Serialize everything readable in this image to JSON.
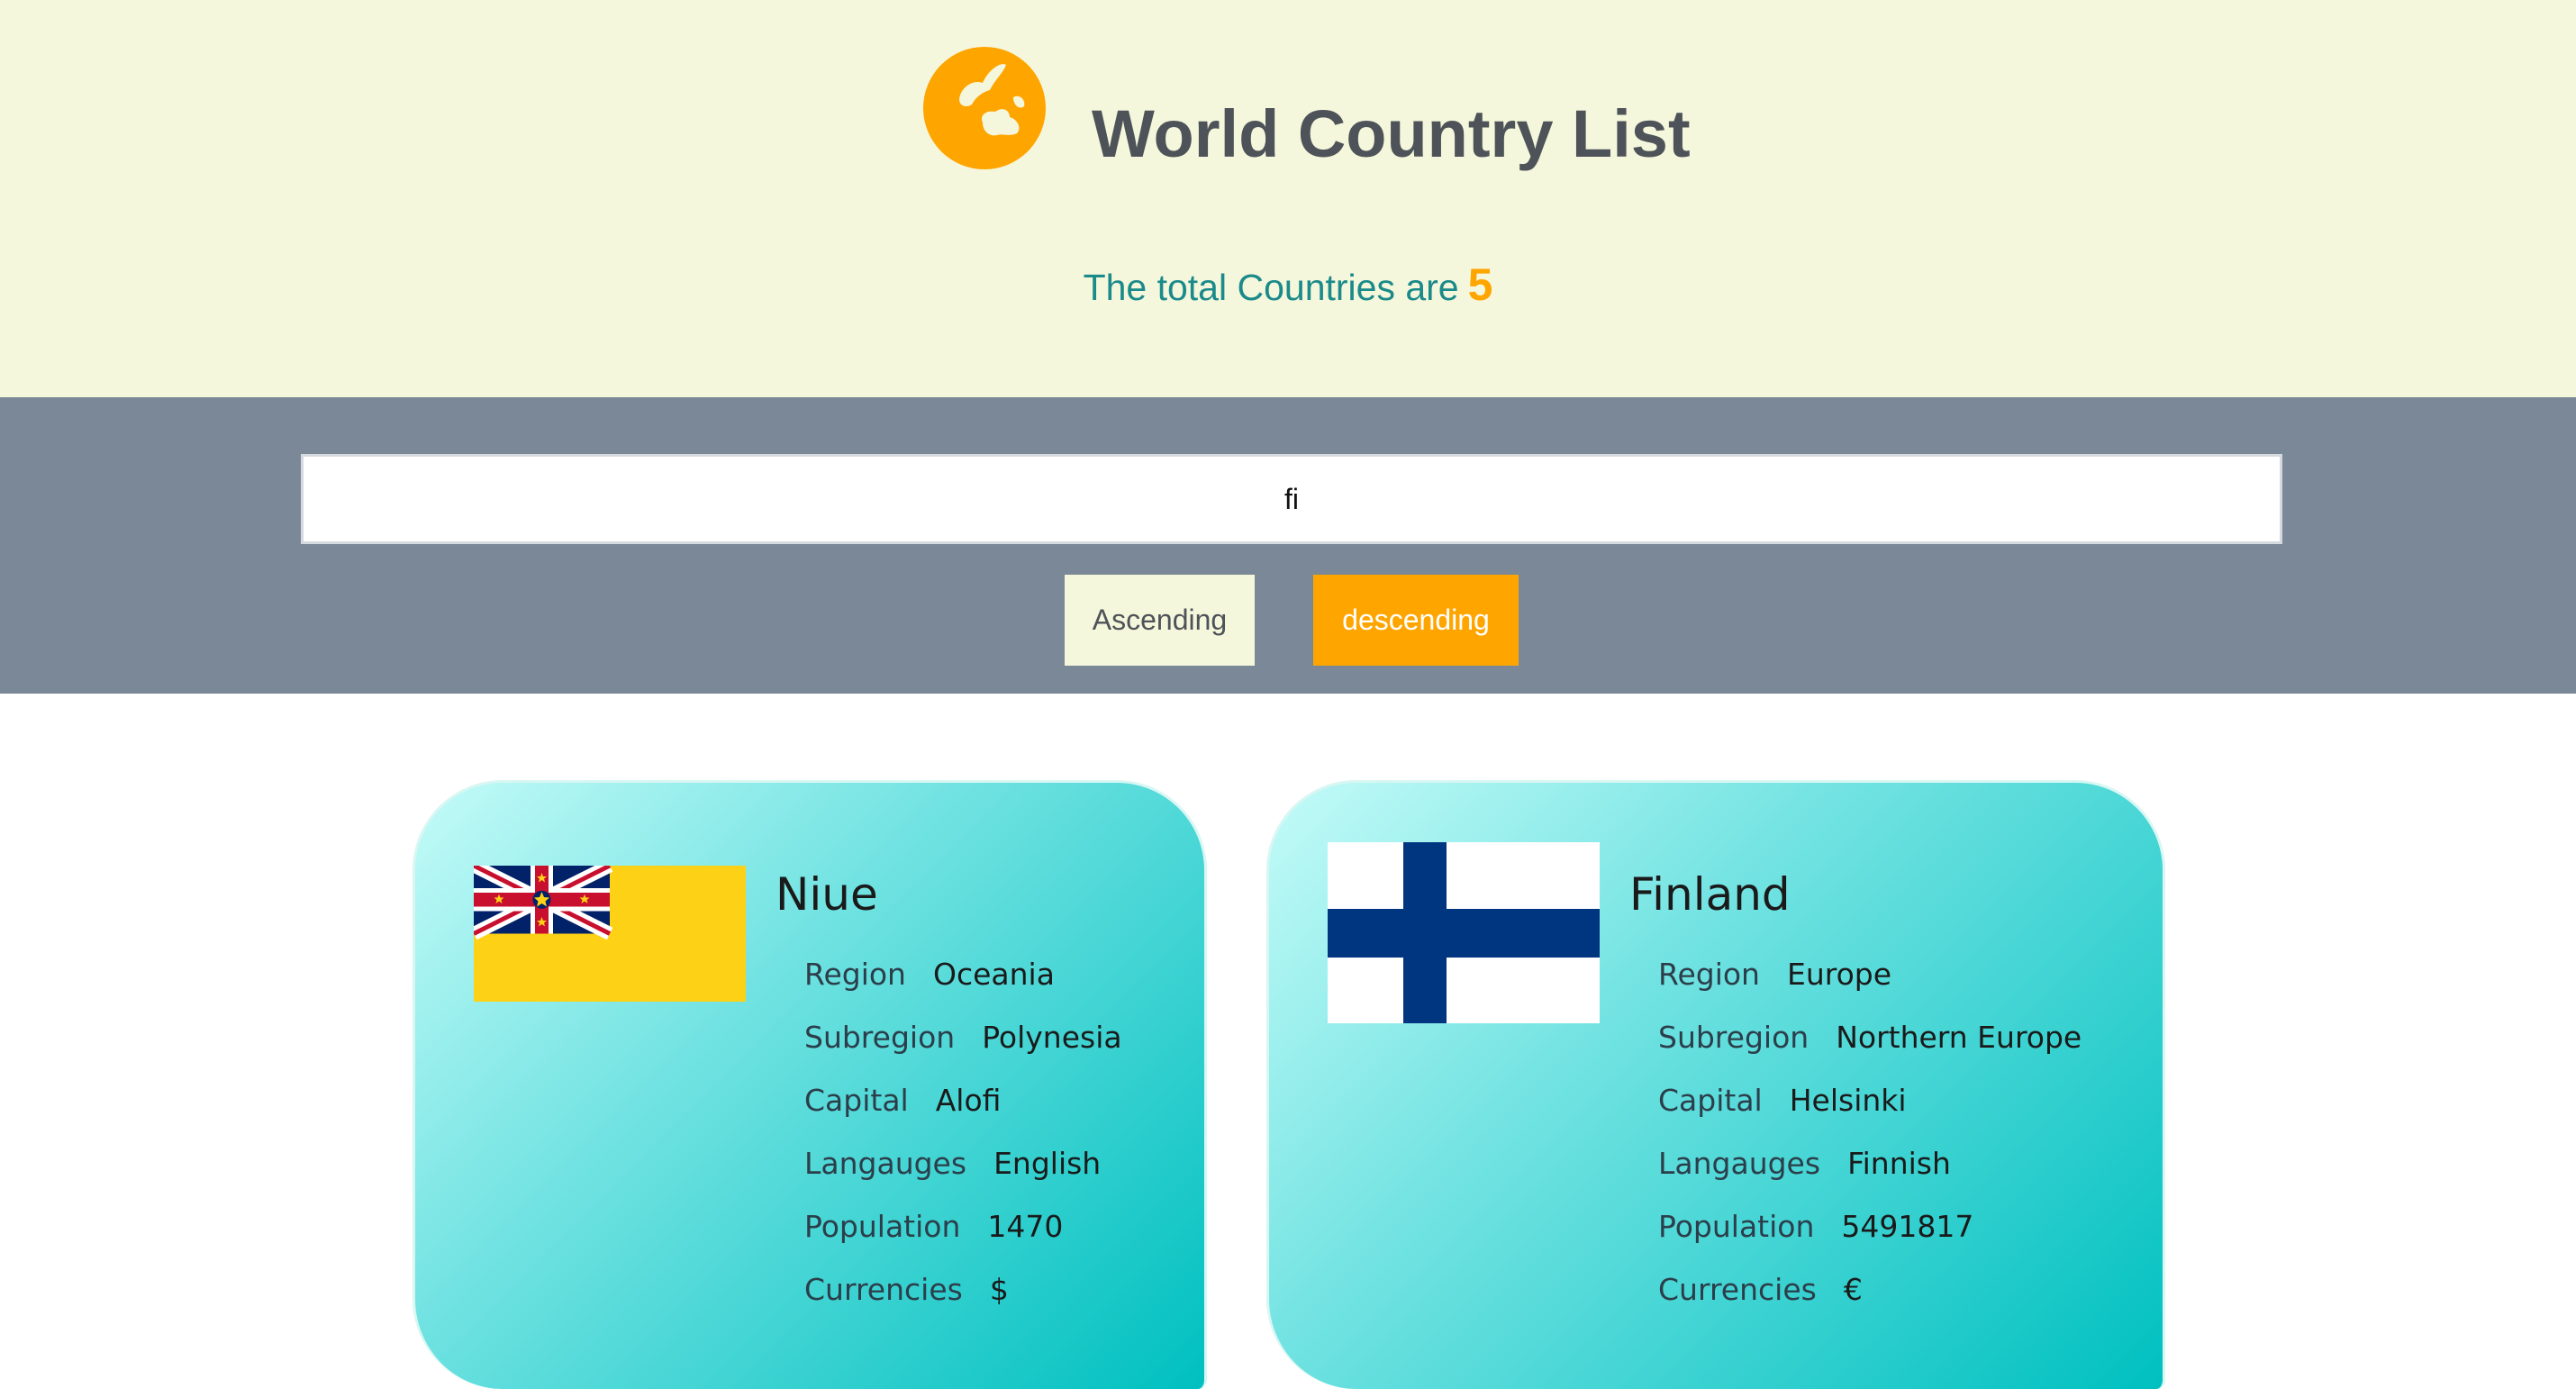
{
  "header": {
    "title": "World Country List",
    "total_prefix": "The total Countries are",
    "total_count": "5",
    "logo_icon": "globe-icon"
  },
  "search": {
    "value": "fi",
    "placeholder": ""
  },
  "sort": {
    "ascending_label": "Ascending",
    "descending_label": "descending"
  },
  "colors": {
    "accent": "#ffa500",
    "header_bg": "#f5f7dc",
    "controls_bg": "#7a8897",
    "total_text": "#1b8a8a"
  },
  "labels": {
    "region": "Region",
    "subregion": "Subregion",
    "capital": "Capital",
    "languages": "Langauges",
    "population": "Population",
    "currencies": "Currencies"
  },
  "countries": [
    {
      "name": "Niue",
      "flag_icon": "niue-flag-icon",
      "region": "Oceania",
      "subregion": "Polynesia",
      "capital": "Alofi",
      "languages": "English",
      "population": "1470",
      "currencies": "$"
    },
    {
      "name": "Finland",
      "flag_icon": "finland-flag-icon",
      "region": "Europe",
      "subregion": "Northern Europe",
      "capital": "Helsinki",
      "languages": "Finnish",
      "population": "5491817",
      "currencies": "€"
    }
  ]
}
